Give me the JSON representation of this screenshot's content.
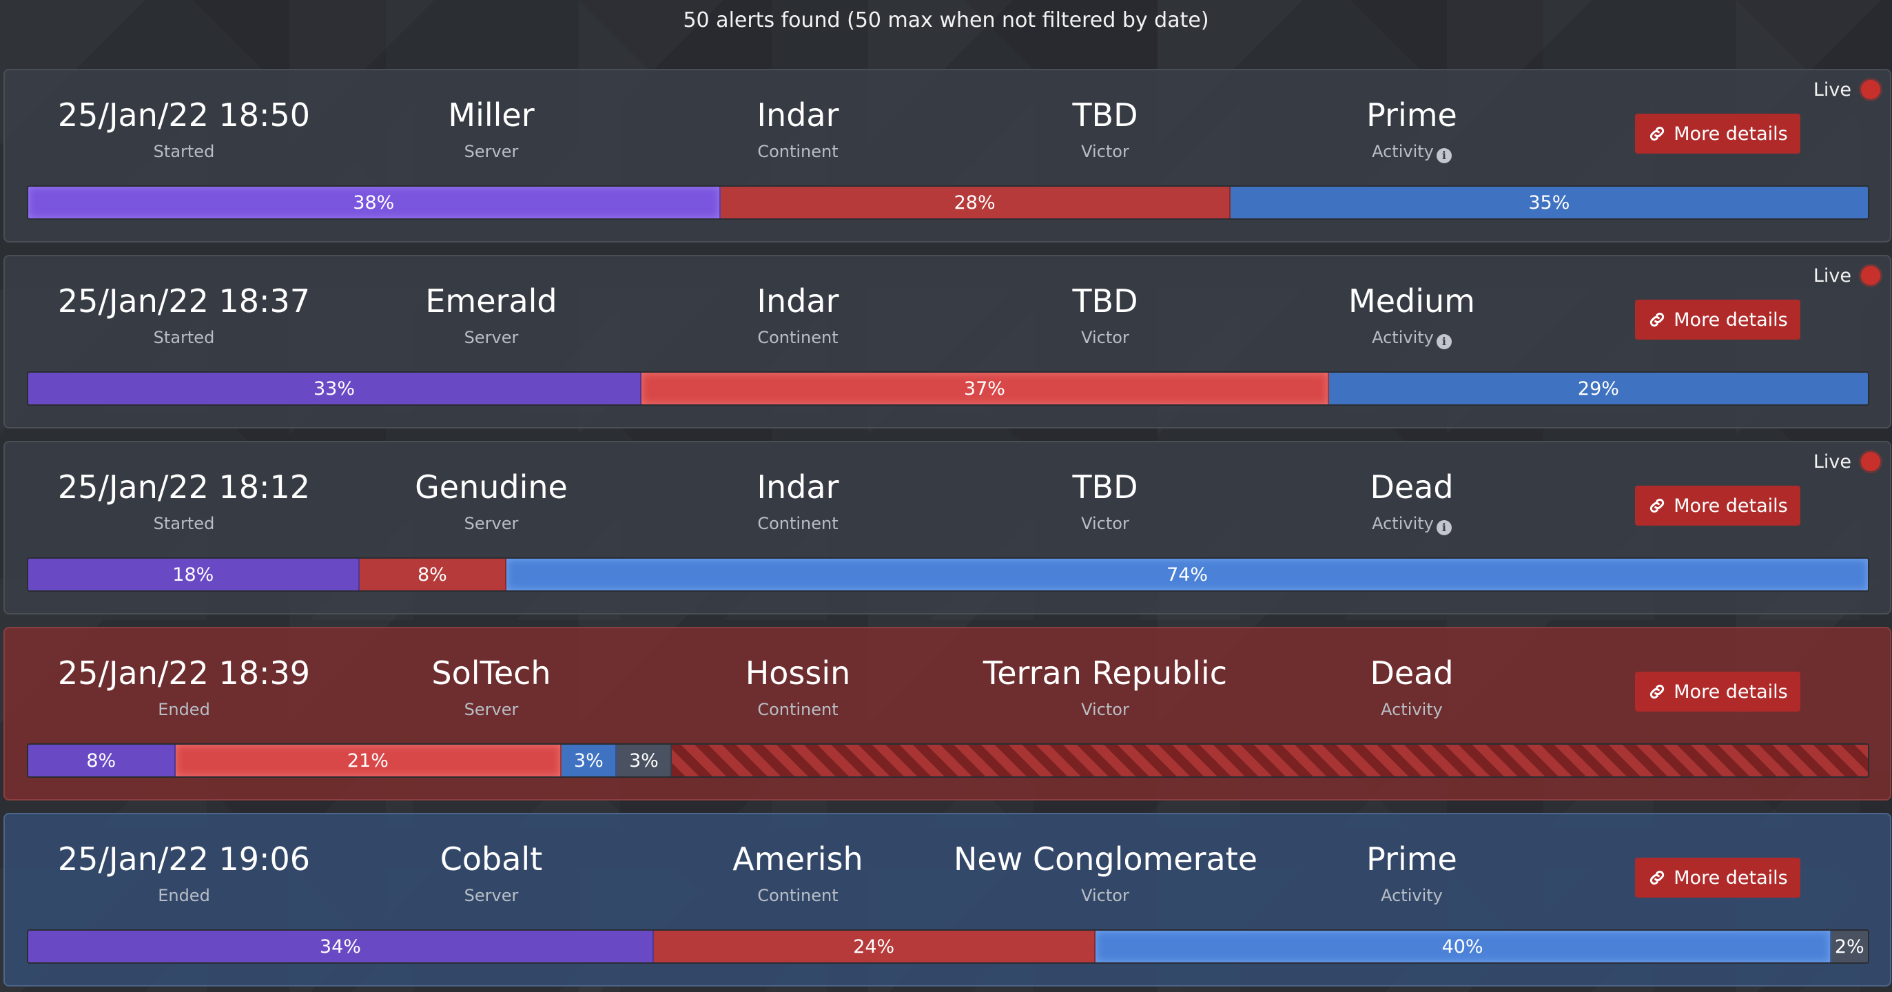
{
  "header": {
    "summary": "50 alerts found (50 max when not filtered by date)"
  },
  "labels": {
    "started": "Started",
    "ended": "Ended",
    "server": "Server",
    "continent": "Continent",
    "victor": "Victor",
    "activity": "Activity",
    "live": "Live",
    "more_details": "More details"
  },
  "colors": {
    "faction_vs": "#6a4ac4",
    "faction_tr": "#b63a3a",
    "faction_nc": "#3f72c0",
    "faction_ns": "#4a5160",
    "button": "#b02a2a",
    "live_dot": "#c8302c"
  },
  "alerts": [
    {
      "time": "25/Jan/22 18:50",
      "time_label": "Started",
      "server": "Miller",
      "continent": "Indar",
      "victor": "TBD",
      "activity": "Prime",
      "live": true,
      "theme": "default",
      "segments": [
        {
          "faction": "VS",
          "pct": 38,
          "text": "38%",
          "style": "glow-purple"
        },
        {
          "faction": "TR",
          "pct": 28,
          "text": "28%",
          "style": "red"
        },
        {
          "faction": "NC",
          "pct": 35,
          "text": "35%",
          "style": "blue"
        }
      ]
    },
    {
      "time": "25/Jan/22 18:37",
      "time_label": "Started",
      "server": "Emerald",
      "continent": "Indar",
      "victor": "TBD",
      "activity": "Medium",
      "live": true,
      "theme": "default",
      "segments": [
        {
          "faction": "VS",
          "pct": 33,
          "text": "33%",
          "style": "purple"
        },
        {
          "faction": "TR",
          "pct": 37,
          "text": "37%",
          "style": "glow-red"
        },
        {
          "faction": "NC",
          "pct": 29,
          "text": "29%",
          "style": "blue"
        }
      ]
    },
    {
      "time": "25/Jan/22 18:12",
      "time_label": "Started",
      "server": "Genudine",
      "continent": "Indar",
      "victor": "TBD",
      "activity": "Dead",
      "live": true,
      "theme": "default",
      "segments": [
        {
          "faction": "VS",
          "pct": 18,
          "text": "18%",
          "style": "purple"
        },
        {
          "faction": "TR",
          "pct": 8,
          "text": "8%",
          "style": "red"
        },
        {
          "faction": "NC",
          "pct": 74,
          "text": "74%",
          "style": "glow-blue"
        }
      ]
    },
    {
      "time": "25/Jan/22 18:39",
      "time_label": "Ended",
      "server": "SolTech",
      "continent": "Hossin",
      "victor": "Terran Republic",
      "activity": "Dead",
      "live": false,
      "theme": "red",
      "segments": [
        {
          "faction": "VS",
          "pct": 8,
          "text": "8%",
          "style": "purple"
        },
        {
          "faction": "TR",
          "pct": 21,
          "text": "21%",
          "style": "glow-red"
        },
        {
          "faction": "NC",
          "pct": 3,
          "text": "3%",
          "style": "blue"
        },
        {
          "faction": "NS",
          "pct": 3,
          "text": "3%",
          "style": "gray"
        },
        {
          "faction": "none",
          "pct": 65,
          "text": "",
          "style": "stripes"
        }
      ]
    },
    {
      "time": "25/Jan/22 19:06",
      "time_label": "Ended",
      "server": "Cobalt",
      "continent": "Amerish",
      "victor": "New Conglomerate",
      "activity": "Prime",
      "live": false,
      "theme": "blue",
      "segments": [
        {
          "faction": "VS",
          "pct": 34,
          "text": "34%",
          "style": "purple"
        },
        {
          "faction": "TR",
          "pct": 24,
          "text": "24%",
          "style": "red"
        },
        {
          "faction": "NC",
          "pct": 40,
          "text": "40%",
          "style": "glow-blue"
        },
        {
          "faction": "NS",
          "pct": 2,
          "text": "2%",
          "style": "gray"
        }
      ]
    }
  ]
}
